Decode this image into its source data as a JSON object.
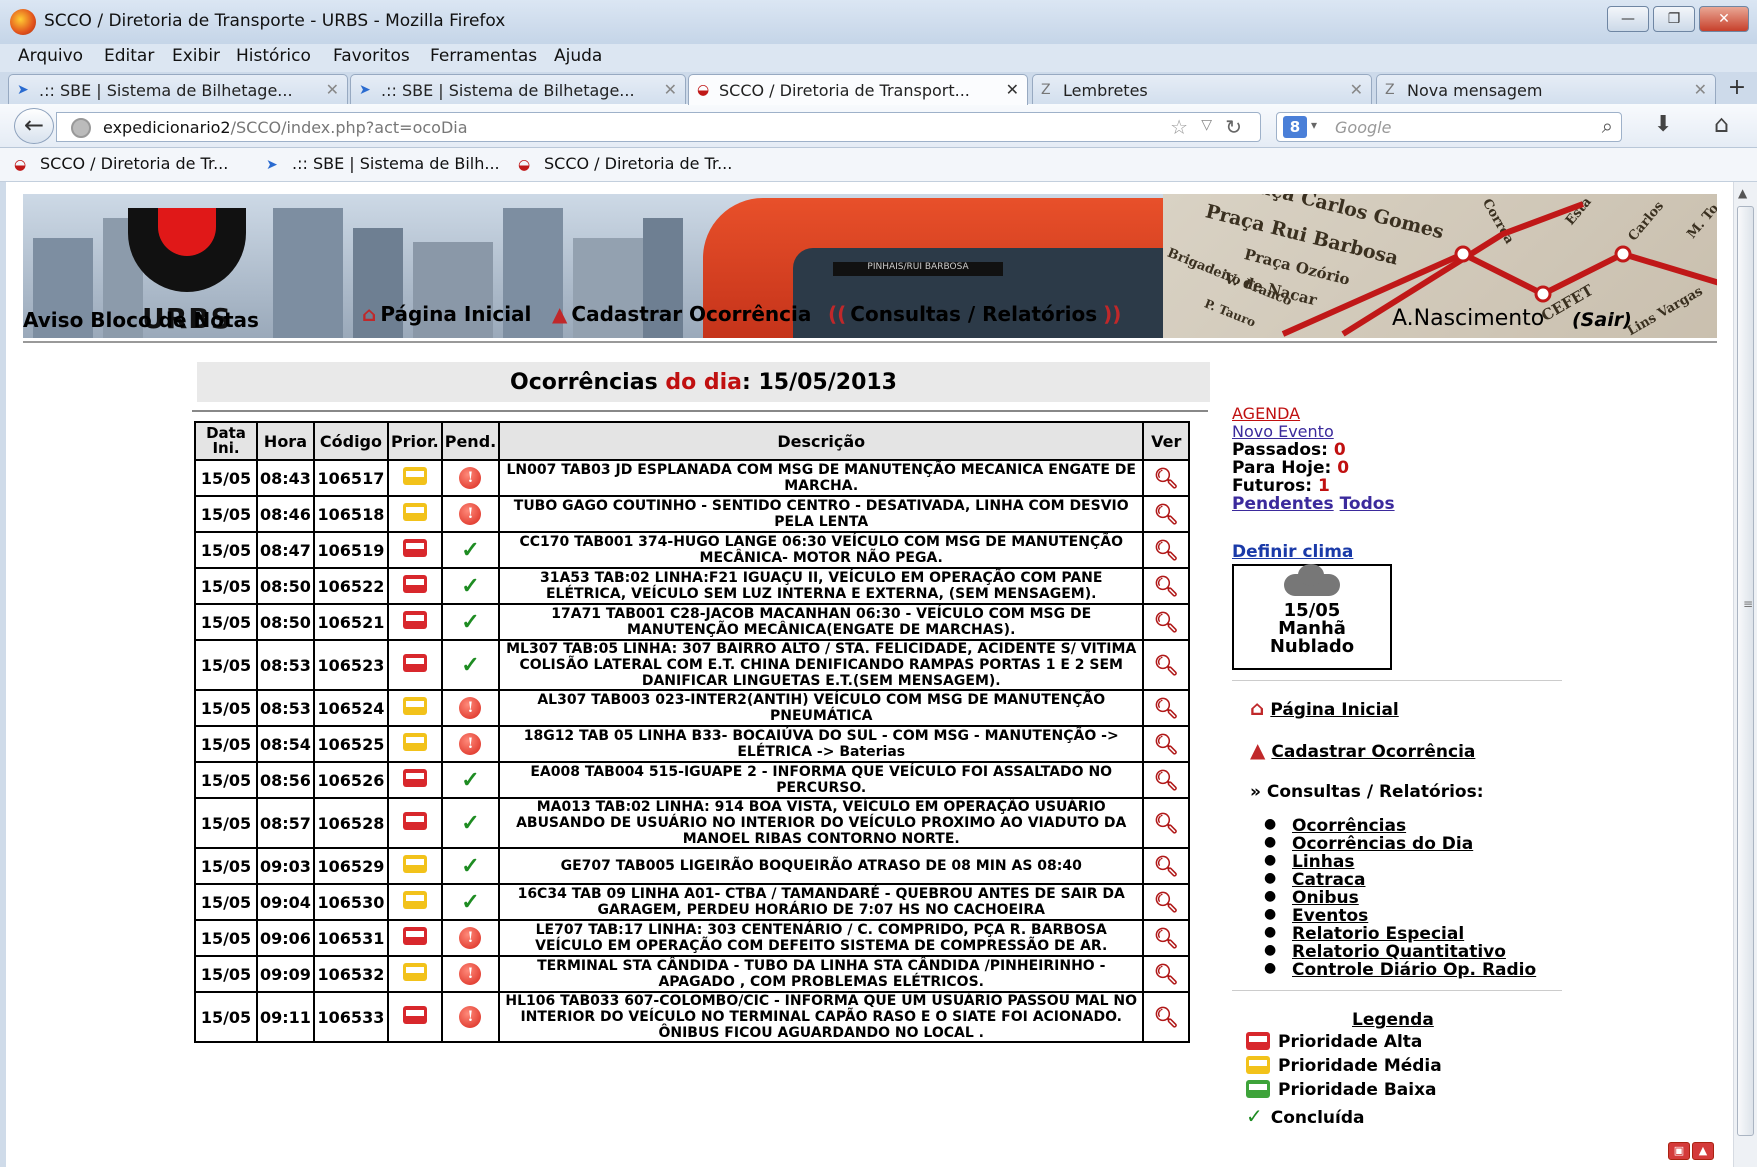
{
  "window": {
    "title": "SCCO / Diretoria de Transporte - URBS - Mozilla Firefox"
  },
  "menubar": [
    "Arquivo",
    "Editar",
    "Exibir",
    "Histórico",
    "Favoritos",
    "Ferramentas",
    "Ajuda"
  ],
  "tabs": [
    {
      "label": ".:: SBE | Sistema de Bilhetage...",
      "icon": "blue-bird-icon"
    },
    {
      "label": ".:: SBE | Sistema de Bilhetage...",
      "icon": "blue-bird-icon"
    },
    {
      "label": "SCCO / Diretoria de Transport...",
      "icon": "urbs-icon",
      "active": true
    },
    {
      "label": "Lembretes",
      "icon": "zimbra-icon"
    },
    {
      "label": "Nova mensagem",
      "icon": "zimbra-icon"
    }
  ],
  "url": {
    "host": "expedicionario2",
    "path": "/SCCO/index.php?act=ocoDia"
  },
  "search": {
    "engine": "8",
    "placeholder": "Google"
  },
  "bookmarks": [
    {
      "label": "SCCO / Diretoria de Tr...",
      "icon": "urbs-icon"
    },
    {
      "label": ".:: SBE | Sistema de Bilh...",
      "icon": "blue-bird-icon"
    },
    {
      "label": "SCCO / Diretoria de Tr...",
      "icon": "urbs-icon"
    }
  ],
  "banner": {
    "logo_text": "URBS",
    "bus_sign": "PINHAIS/RUI BARBOSA",
    "map_labels": [
      "Praça Carlos Gomes",
      "Praça Rui Barbosa",
      "Praça Ozório",
      "V. de Nacar",
      "Brigadeiro Franco",
      "P. Tauro",
      "CEFET",
      "Lins Vargas",
      "Carlos",
      "M. To",
      "Esta",
      "Correa"
    ]
  },
  "nav": {
    "aviso": "Aviso Bloco de Notas",
    "pagina_inicial": "Página Inicial",
    "cadastrar": "Cadastrar Ocorrência",
    "consultas": "Consultas / Relatórios",
    "user": "A.Nascimento",
    "sair": "(Sair)"
  },
  "header": {
    "prefix": "Ocorrências",
    "mid": "do dia",
    "date": ": 15/05/2013"
  },
  "table": {
    "columns": [
      "Data Ini.",
      "Hora",
      "Código",
      "Prior.",
      "Pend.",
      "Descrição",
      "Ver"
    ],
    "rows": [
      {
        "data": "15/05",
        "hora": "08:43",
        "codigo": "106517",
        "prior": "media",
        "pend": "pending",
        "desc": "LN007 TAB03 JD ESPLANADA COM MSG DE MANUTENÇÃO MECANICA ENGATE DE MARCHA."
      },
      {
        "data": "15/05",
        "hora": "08:46",
        "codigo": "106518",
        "prior": "media",
        "pend": "pending",
        "desc": "TUBO GAGO COUTINHO - SENTIDO CENTRO - DESATIVADA, LINHA COM DESVIO PELA LENTA"
      },
      {
        "data": "15/05",
        "hora": "08:47",
        "codigo": "106519",
        "prior": "alta",
        "pend": "done",
        "desc": "CC170 TAB001 374-HUGO LANGE 06:30 VEÍCULO COM MSG DE MANUTENÇÃO MECÂNICA- MOTOR NÃO PEGA."
      },
      {
        "data": "15/05",
        "hora": "08:50",
        "codigo": "106522",
        "prior": "alta",
        "pend": "done",
        "desc": "31A53 TAB:02 LINHA:F21 IGUAÇU II, VEÍCULO EM OPERAÇÃO COM PANE ELÉTRICA, VEÍCULO SEM LUZ INTERNA E EXTERNA, (SEM MENSAGEM)."
      },
      {
        "data": "15/05",
        "hora": "08:50",
        "codigo": "106521",
        "prior": "alta",
        "pend": "done",
        "desc": "17A71 TAB001 C28-JACOB MACANHAN 06:30 - VEÍCULO COM MSG DE MANUTENÇÃO MECÂNICA(ENGATE DE MARCHAS)."
      },
      {
        "data": "15/05",
        "hora": "08:53",
        "codigo": "106523",
        "prior": "alta",
        "pend": "done",
        "desc": "ML307 TAB:05 LINHA: 307 BAIRRO ALTO / STA. FELICIDADE, ACIDENTE S/ VITIMA COLISÃO LATERAL COM E.T. CHINA DENIFICANDO RAMPAS PORTAS 1 E 2 SEM DANIFICAR LINGUETAS E.T.(SEM MENSAGEM)."
      },
      {
        "data": "15/05",
        "hora": "08:53",
        "codigo": "106524",
        "prior": "media",
        "pend": "pending",
        "desc": "AL307 TAB003 023-INTER2(ANTIH) VEÍCULO COM MSG DE MANUTENÇÃO PNEUMÁTICA"
      },
      {
        "data": "15/05",
        "hora": "08:54",
        "codigo": "106525",
        "prior": "media",
        "pend": "pending",
        "desc": "18G12 TAB 05 LINHA B33- BOCAIÚVA DO SUL - COM MSG - MANUTENÇÃO -> ELÉTRICA -> Baterias"
      },
      {
        "data": "15/05",
        "hora": "08:56",
        "codigo": "106526",
        "prior": "alta",
        "pend": "done",
        "desc": "EA008 TAB004 515-IGUAPE 2 - INFORMA QUE VEÍCULO FOI ASSALTADO NO PERCURSO."
      },
      {
        "data": "15/05",
        "hora": "08:57",
        "codigo": "106528",
        "prior": "alta",
        "pend": "done",
        "desc": "MA013 TAB:02 LINHA: 914 BOA VISTA, VEÍCULO EM OPERAÇÃO USUÁRIO ABUSANDO DE USUÁRIO NO INTERIOR DO VEÍCULO PROXIMO AO VIADUTO DA MANOEL RIBAS CONTORNO NORTE."
      },
      {
        "data": "15/05",
        "hora": "09:03",
        "codigo": "106529",
        "prior": "media",
        "pend": "done",
        "desc": "GE707 TAB005 LIGEIRÃO BOQUEIRÃO ATRASO DE 08 MIN AS 08:40"
      },
      {
        "data": "15/05",
        "hora": "09:04",
        "codigo": "106530",
        "prior": "media",
        "pend": "done",
        "desc": "16C34 TAB 09 LINHA A01- CTBA / TAMANDARÉ - QUEBROU ANTES DE SAIR DA GARAGEM, PERDEU HORÁRIO DE 7:07 HS NO CACHOEIRA"
      },
      {
        "data": "15/05",
        "hora": "09:06",
        "codigo": "106531",
        "prior": "alta",
        "pend": "pending",
        "desc": "LE707 TAB:17 LINHA: 303 CENTENÁRIO / C. COMPRIDO, PÇA R. BARBOSA VEÍCULO EM OPERAÇÃO COM DEFEITO SISTEMA DE COMPRESSÃO DE AR."
      },
      {
        "data": "15/05",
        "hora": "09:09",
        "codigo": "106532",
        "prior": "media",
        "pend": "pending",
        "desc": "TERMINAL STA CÂNDIDA - TUBO DA LINHA STA CÂNDIDA /PINHEIRINHO - APAGADO , COM PROBLEMAS ELÉTRICOS."
      },
      {
        "data": "15/05",
        "hora": "09:11",
        "codigo": "106533",
        "prior": "alta",
        "pend": "pending",
        "desc": "HL106 TAB033 607-COLOMBO/CIC - INFORMA QUE UM USUÁRIO PASSOU MAL NO INTERIOR DO VEÍCULO NO TERMINAL CAPÃO RASO E O SIATE FOI ACIONADO. ÔNIBUS FICOU AGUARDANDO NO LOCAL ."
      }
    ]
  },
  "agenda": {
    "title": "AGENDA",
    "novo_evento": "Novo Evento",
    "passados_label": "Passados:",
    "passados": "0",
    "hoje_label": "Para Hoje:",
    "hoje": "0",
    "futuros_label": "Futuros:",
    "futuros": "1",
    "pendentes": "Pendentes",
    "todos": "Todos"
  },
  "clima": {
    "link": "Definir clima",
    "date": "15/05",
    "periodo": "Manhã",
    "cond": "Nublado"
  },
  "side_menu": {
    "pagina_inicial": "Página Inicial",
    "cadastrar": "Cadastrar Ocorrência",
    "consultas_label": "» Consultas / Relatórios:",
    "items": [
      "Ocorrências",
      "Ocorrências do Dia",
      "Linhas",
      "Catraca",
      "Onibus",
      "Eventos",
      "Relatorio Especial",
      "Relatorio Quantitativo",
      "Controle Diário Op. Radio"
    ]
  },
  "legend": {
    "title": "Legenda",
    "items": [
      {
        "label": "Prioridade Alta",
        "color": "#d8272c"
      },
      {
        "label": "Prioridade Média",
        "color": "#f2c21a"
      },
      {
        "label": "Prioridade Baixa",
        "color": "#3ea33a"
      },
      {
        "label": "Concluída",
        "color": "#1e8c22"
      }
    ]
  },
  "colors": {
    "alta": "#d8272c",
    "media": "#f2c21a",
    "baixa": "#3ea33a"
  }
}
